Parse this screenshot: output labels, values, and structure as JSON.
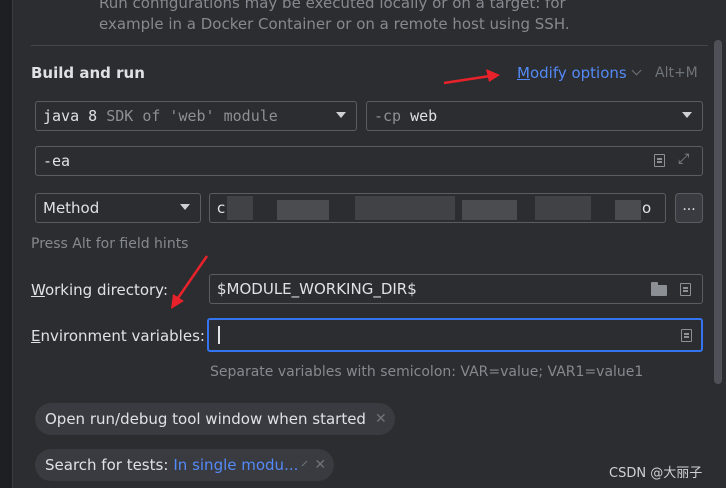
{
  "top_note": {
    "line1": "Run configurations may be executed locally or on a target: for",
    "line2": "example in a Docker Container or on a remote host using SSH."
  },
  "build_and_run": {
    "title": "Build and run",
    "modify_options_underlined": "M",
    "modify_options_rest": "odify options",
    "shortcut": "Alt+M",
    "sdk_dropdown": {
      "main": "java 8",
      "dim": "SDK of 'web' module"
    },
    "classpath_dropdown": {
      "dim": "-cp",
      "main": "web"
    },
    "vm_options_value": "-ea",
    "kind_dropdown_value": "Method",
    "method_field_start": "c",
    "method_field_end": "o",
    "browse_button": "...",
    "field_hint": "Press Alt for field hints"
  },
  "working_directory": {
    "label_underlined": "W",
    "label_rest": "orking directory:",
    "value": "$MODULE_WORKING_DIR$"
  },
  "environment_variables": {
    "label_underlined": "E",
    "label_rest": "nvironment variables:",
    "value": "",
    "hint": "Separate variables with semicolon: VAR=value; VAR1=value1"
  },
  "chips": {
    "open_tool_window": "Open run/debug tool window when started",
    "search_label": "Search for tests:",
    "search_value": "In single modu...",
    "close_glyph": "✕"
  },
  "watermark": "CSDN @大丽子",
  "colors": {
    "background": "#2b2d30",
    "accent": "#548af7",
    "focus": "#3574f0",
    "arrow": "#e8222a"
  }
}
